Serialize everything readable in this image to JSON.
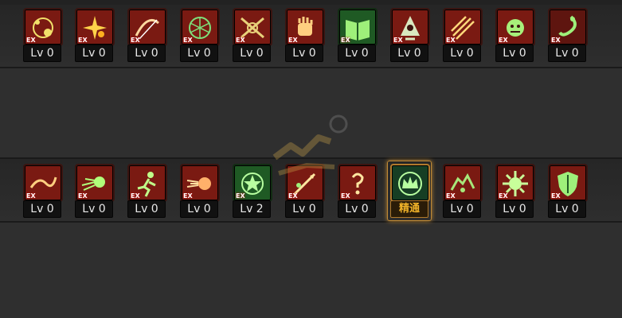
{
  "row1": [
    {
      "icon": "spiral-orbs-icon",
      "level": "Lv 0",
      "tier": "ex",
      "color": "red"
    },
    {
      "icon": "sparkle-burst-icon",
      "level": "Lv 0",
      "tier": "ex",
      "color": "red"
    },
    {
      "icon": "slash-arc-icon",
      "level": "Lv 0",
      "tier": "ex",
      "color": "red"
    },
    {
      "icon": "rune-circle-icon",
      "level": "Lv 0",
      "tier": "ex",
      "color": "red"
    },
    {
      "icon": "crossed-blades-icon",
      "level": "Lv 0",
      "tier": "ex",
      "color": "red"
    },
    {
      "icon": "fist-icon",
      "level": "Lv 0",
      "tier": "ex",
      "color": "red"
    },
    {
      "icon": "book-icon",
      "level": "Lv 0",
      "tier": "ex",
      "color": "green"
    },
    {
      "icon": "hooded-figure-icon",
      "level": "Lv 0",
      "tier": "ex",
      "color": "red"
    },
    {
      "icon": "claw-strike-icon",
      "level": "Lv 0",
      "tier": "ex",
      "color": "red"
    },
    {
      "icon": "monster-head-icon",
      "level": "Lv 0",
      "tier": "ex",
      "color": "red"
    },
    {
      "icon": "hook-icon",
      "level": "Lv 0",
      "tier": "ex",
      "color": "dark"
    }
  ],
  "row2": [
    {
      "icon": "whip-icon",
      "level": "Lv 0",
      "tier": "ex",
      "color": "red"
    },
    {
      "icon": "comet-icon",
      "level": "Lv 0",
      "tier": "ex",
      "color": "red"
    },
    {
      "icon": "runner-icon",
      "level": "Lv 0",
      "tier": "ex",
      "color": "red"
    },
    {
      "icon": "fire-dash-icon",
      "level": "Lv 0",
      "tier": "ex",
      "color": "red"
    },
    {
      "icon": "star-circle-icon",
      "level": "Lv 2",
      "tier": "ex",
      "color": "green"
    },
    {
      "icon": "spear-thrust-icon",
      "level": "Lv 0",
      "tier": "ex",
      "color": "red"
    },
    {
      "icon": "mystery-strike-icon",
      "level": "Lv 0",
      "tier": "ex",
      "color": "red"
    },
    {
      "icon": "crown-circle-icon",
      "level": "精通",
      "tier": "",
      "color": "green",
      "highlight": true
    },
    {
      "icon": "shadow-beast-icon",
      "level": "Lv 0",
      "tier": "ex",
      "color": "red"
    },
    {
      "icon": "gear-burst-icon",
      "level": "Lv 0",
      "tier": "ex",
      "color": "red"
    },
    {
      "icon": "shield-icon",
      "level": "Lv 0",
      "tier": "ex",
      "color": "red"
    }
  ],
  "badge_text": "EX",
  "colors": {
    "accent_gold": "#f1b329",
    "icon_red": "#7a1a12",
    "icon_green": "#1f5a24",
    "glyph": "#9ef07a"
  }
}
